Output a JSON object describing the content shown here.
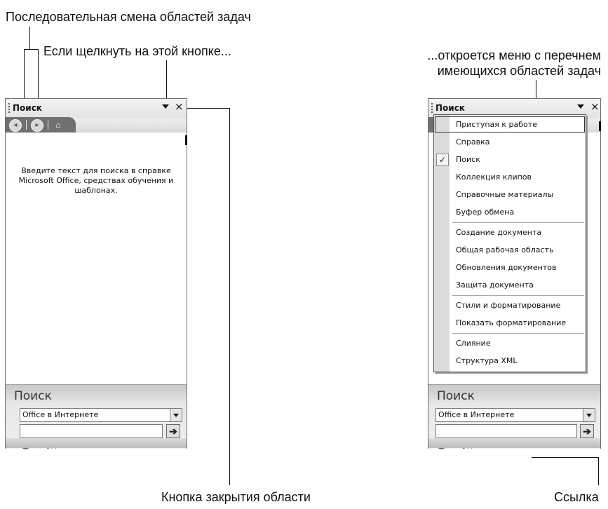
{
  "annotations": {
    "top_left": "Последовательная смена областей задач",
    "click_hint": "Если щелкнуть на этой кнопке...",
    "menu_hint_line1": "...откроется меню с перечнем",
    "menu_hint_line2": "имеющихся областей задач",
    "close_label": "Кнопка закрытия области",
    "link_label": "Ссылка"
  },
  "left_pane": {
    "title": "Поиск",
    "close_glyph": "×",
    "help_line1": "Введите текст для поиска в справке",
    "help_line2": "Microsoft Office, средствах обучения и",
    "help_line3": "шаблонах.",
    "search_heading": "Поиск",
    "scope_value": "Office в Интернете",
    "search_value": "",
    "cant_find": "Не удается найти?"
  },
  "right_pane": {
    "title": "Поиск",
    "close_glyph": "×",
    "search_heading": "Поиск",
    "scope_value": "Office в Интернете",
    "search_value": "",
    "cant_find": "Не удается найти?"
  },
  "menu": {
    "items": [
      {
        "label": "Приступая к работе",
        "highlighted": true
      },
      {
        "label": "Справка"
      },
      {
        "label": "Поиск",
        "checked": true
      },
      {
        "label": "Коллекция клипов"
      },
      {
        "label": "Справочные материалы"
      },
      {
        "label": "Буфер обмена"
      },
      {
        "label": "Создание документа"
      },
      {
        "label": "Общая рабочая область"
      },
      {
        "label": "Обновления документов"
      },
      {
        "label": "Защита документа"
      },
      {
        "label": "Стили и форматирование"
      },
      {
        "label": "Показать форматирование"
      },
      {
        "label": "Слияние"
      },
      {
        "label": "Структура XML"
      }
    ],
    "check_glyph": "✓"
  },
  "icons": {
    "back": "back-arrow-icon",
    "forward": "forward-arrow-icon",
    "home": "home-icon",
    "dropdown": "dropdown-arrow-icon",
    "close": "close-icon",
    "go": "go-arrow-icon",
    "help": "help-question-icon"
  }
}
